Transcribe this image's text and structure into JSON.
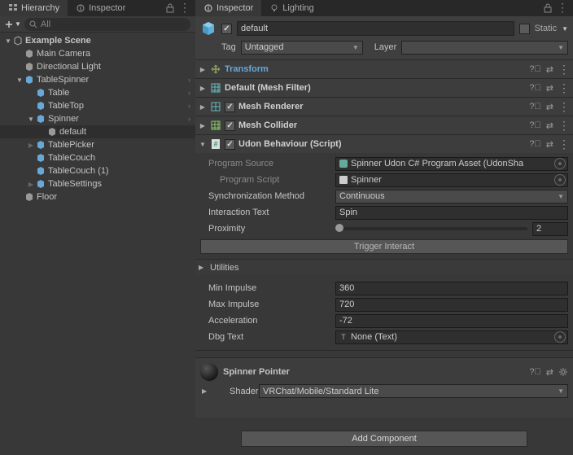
{
  "left": {
    "tab_hierarchy": "Hierarchy",
    "tab_inspector": "Inspector",
    "search_placeholder": "All",
    "tree": {
      "root": "Example Scene",
      "main_camera": "Main Camera",
      "dir_light": "Directional Light",
      "table_spinner": "TableSpinner",
      "table": "Table",
      "table_top": "TableTop",
      "spinner": "Spinner",
      "default": "default",
      "table_picker": "TablePicker",
      "table_couch": "TableCouch",
      "table_couch1": "TableCouch (1)",
      "table_settings": "TableSettings",
      "floor": "Floor"
    }
  },
  "insp": {
    "tab_inspector": "Inspector",
    "tab_lighting": "Lighting",
    "name": "default",
    "static": "Static",
    "tag_label": "Tag",
    "tag_value": "Untagged",
    "layer_label": "Layer",
    "layer_value": "",
    "transform": "Transform",
    "mesh_filter": "Default (Mesh Filter)",
    "mesh_renderer": "Mesh Renderer",
    "mesh_collider": "Mesh Collider",
    "udon": {
      "title": "Udon Behaviour (Script)",
      "prog_src_lbl": "Program Source",
      "prog_src_val": "Spinner Udon C# Program Asset (UdonSha",
      "prog_script_lbl": "Program Script",
      "prog_script_val": "Spinner",
      "sync_lbl": "Synchronization Method",
      "sync_val": "Continuous",
      "inter_lbl": "Interaction Text",
      "inter_val": "Spin",
      "prox_lbl": "Proximity",
      "prox_val": "2",
      "trigger": "Trigger Interact",
      "utilities": "Utilities",
      "min_imp_lbl": "Min Impulse",
      "min_imp_val": "360",
      "max_imp_lbl": "Max Impulse",
      "max_imp_val": "720",
      "accel_lbl": "Acceleration",
      "accel_val": "-72",
      "dbg_lbl": "Dbg Text",
      "dbg_val": "None (Text)"
    },
    "mat": {
      "title": "Spinner Pointer",
      "shader_lbl": "Shader",
      "shader_val": "VRChat/Mobile/Standard Lite"
    },
    "add_component": "Add Component"
  }
}
